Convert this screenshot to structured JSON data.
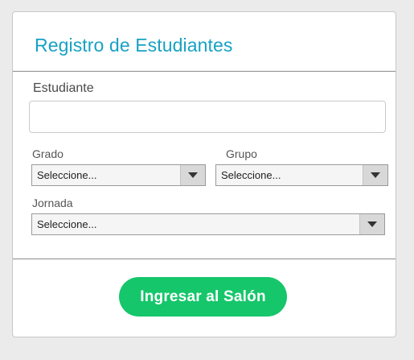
{
  "form": {
    "title": "Registro de Estudiantes",
    "student_label": "Estudiante",
    "student_value": "",
    "student_placeholder": "",
    "grade_label": "Grado",
    "grade_selected": "Seleccione...",
    "group_label": "Grupo",
    "group_selected": "Seleccione...",
    "shift_label": "Jornada",
    "shift_selected": "Seleccione...",
    "submit_label": "Ingresar al Salón"
  },
  "colors": {
    "title": "#17a2c4",
    "submit_bg": "#15c66a",
    "page_bg": "#ebebeb"
  },
  "icons": {
    "select_arrow": "chevron-down-icon"
  }
}
